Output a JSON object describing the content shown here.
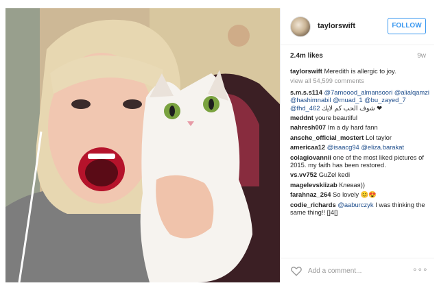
{
  "post": {
    "username": "taylorswift",
    "follow_label": "FOLLOW",
    "likes": "2.4m likes",
    "age": "9w"
  },
  "caption": {
    "username": "taylorswift",
    "text": "Meredith is allergic to joy."
  },
  "view_all": "view all 54,599 comments",
  "comments": [
    {
      "user": "s.m.s.s114",
      "mentions": "@7amoood_almansoori @alialqamzi @hashimnabil @muad_1 @bu_zayed_7 @fhd_462",
      "text": "شوف الحب كم لايك ❤"
    },
    {
      "user": "meddnt",
      "mentions": "",
      "text": "youre beautiful"
    },
    {
      "user": "nahresh007",
      "mentions": "",
      "text": "Im a dy hard fann"
    },
    {
      "user": "ansche_official_mostert",
      "mentions": "",
      "text": "Lol taylor"
    },
    {
      "user": "americaa12",
      "mentions": "@isaacg94 @eliza.barakat",
      "text": ""
    },
    {
      "user": "colagiovannii",
      "mentions": "",
      "text": "one of the most liked pictures of 2015. my faith has been restored."
    },
    {
      "user": "vs.vv752",
      "mentions": "",
      "text": "GuZel kedi"
    },
    {
      "user": "magelevskiizab",
      "mentions": "",
      "text": "Клевая))"
    },
    {
      "user": "farahnaz_264",
      "mentions": "",
      "text": "So lovely 😊😍"
    },
    {
      "user": "codie_richards",
      "mentions": "@aaburczyk",
      "text": "I was thinking the same thing!! []4[]"
    }
  ],
  "footer": {
    "placeholder": "Add a comment...",
    "more": "∘∘∘"
  },
  "icons": {
    "avatar": "profile-avatar",
    "like": "heart-outline-icon",
    "options": "more-options-icon"
  },
  "colors": {
    "accent": "#3897f0",
    "mention": "#1b4b8a",
    "muted": "#999999",
    "text": "#262626"
  }
}
